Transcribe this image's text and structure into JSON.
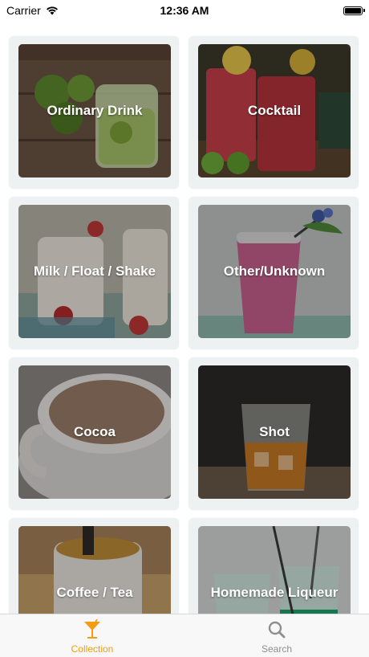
{
  "status": {
    "carrier": "Carrier",
    "time": "12:36 AM"
  },
  "categories": [
    {
      "label": "Ordinary Drink"
    },
    {
      "label": "Cocktail"
    },
    {
      "label": "Milk / Float / Shake"
    },
    {
      "label": "Other/Unknown"
    },
    {
      "label": "Cocoa"
    },
    {
      "label": "Shot"
    },
    {
      "label": "Coffee / Tea"
    },
    {
      "label": "Homemade Liqueur"
    }
  ],
  "tabs": [
    {
      "label": "Collection",
      "icon": "cocktail-glass-icon",
      "active": true
    },
    {
      "label": "Search",
      "icon": "search-icon",
      "active": false
    }
  ],
  "colors": {
    "accent": "#f39c12",
    "inactive": "#8e8e8e",
    "card_bg": "#eef1f2"
  }
}
